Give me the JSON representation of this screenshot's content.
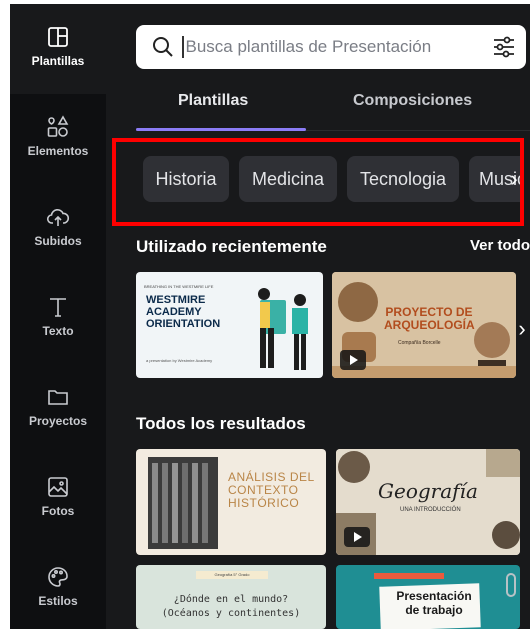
{
  "rail": {
    "items": [
      {
        "label": "Plantillas",
        "icon": "template-icon"
      },
      {
        "label": "Elementos",
        "icon": "shapes-icon"
      },
      {
        "label": "Subidos",
        "icon": "cloud-upload-icon"
      },
      {
        "label": "Texto",
        "icon": "text-icon"
      },
      {
        "label": "Proyectos",
        "icon": "folder-icon"
      },
      {
        "label": "Fotos",
        "icon": "image-icon"
      },
      {
        "label": "Estilos",
        "icon": "palette-icon"
      }
    ]
  },
  "search": {
    "placeholder": "Busca plantillas de Presentación"
  },
  "tabs": [
    {
      "label": "Plantillas",
      "active": true
    },
    {
      "label": "Composiciones",
      "active": false
    }
  ],
  "chips": [
    "Historia",
    "Medicina",
    "Tecnologia",
    "Music"
  ],
  "recent": {
    "title": "Utilizado recientemente",
    "see_all": "Ver todo",
    "cards": [
      {
        "kicker": "BREATHING IN THE WESTMIRE LIFE",
        "title_lines": [
          "WESTMIRE",
          "ACADEMY",
          "ORIENTATION"
        ],
        "footer": "a presentation by Westmire Academy"
      },
      {
        "title_lines": [
          "PROYECTO DE",
          "ARQUEOLOGÍA"
        ],
        "footer": "Compañía Borcelle"
      }
    ]
  },
  "results": {
    "title": "Todos los resultados",
    "cards": [
      {
        "title_lines": [
          "ANÁLISIS DEL",
          "CONTEXTO",
          "HISTÓRICO"
        ]
      },
      {
        "title": "Geografía",
        "subtitle": "UNA INTRODUCCIÓN"
      },
      {
        "kicker": "Geografía 5° Grado",
        "title_lines": [
          "¿Dónde en el mundo?",
          "(Océanos y continentes)"
        ]
      },
      {
        "title_lines": [
          "Presentación",
          "de trabajo"
        ]
      }
    ]
  },
  "colors": {
    "accent": "#8b7cf6",
    "highlight_box": "#ff0000",
    "panel_bg": "#18191b",
    "rail_bg": "#0e0f11"
  }
}
